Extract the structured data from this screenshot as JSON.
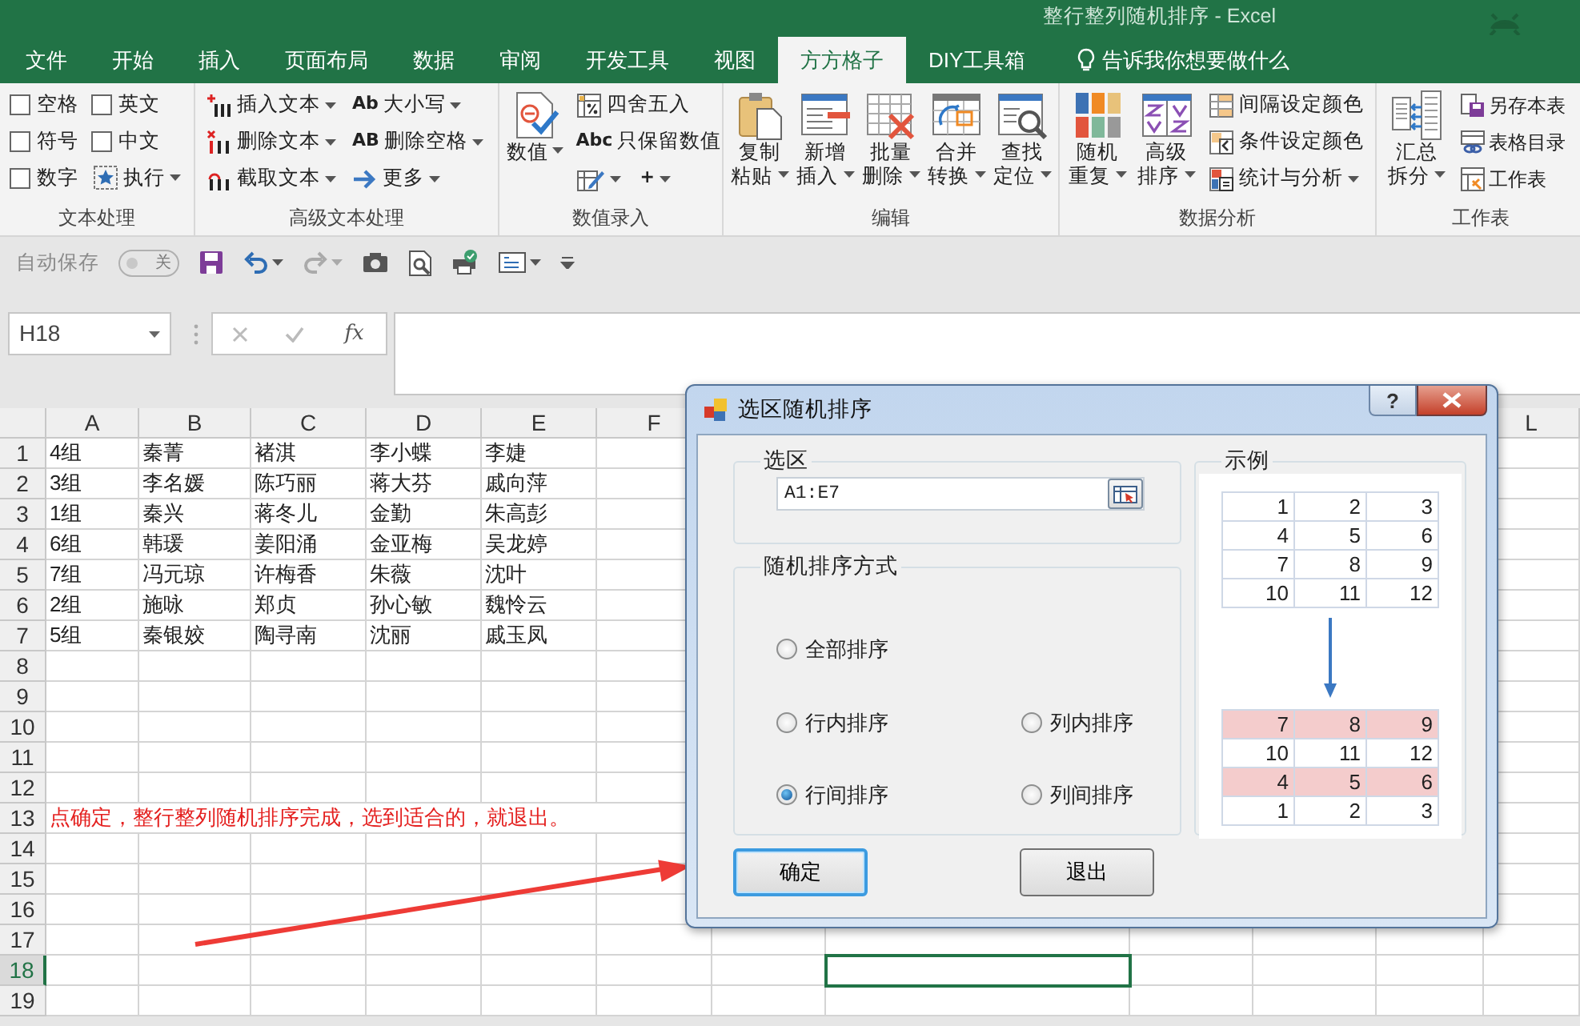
{
  "window": {
    "title": "整行整列随机排序  -  Excel"
  },
  "tabs": [
    {
      "label": "文件",
      "selected": false
    },
    {
      "label": "开始",
      "selected": false
    },
    {
      "label": "插入",
      "selected": false
    },
    {
      "label": "页面布局",
      "selected": false
    },
    {
      "label": "数据",
      "selected": false
    },
    {
      "label": "审阅",
      "selected": false
    },
    {
      "label": "开发工具",
      "selected": false
    },
    {
      "label": "视图",
      "selected": false
    },
    {
      "label": "方方格子",
      "selected": true
    },
    {
      "label": "DIY工具箱",
      "selected": false
    }
  ],
  "tell_me": "告诉我你想要做什么",
  "ribbon": {
    "groups": [
      {
        "label": "文本处理",
        "items": [
          {
            "kind": "checkbox",
            "label": "空格",
            "checked": false
          },
          {
            "kind": "checkbox",
            "label": "英文",
            "checked": false
          },
          {
            "kind": "checkbox",
            "label": "符号",
            "checked": false
          },
          {
            "kind": "checkbox",
            "label": "中文",
            "checked": false
          },
          {
            "kind": "checkbox",
            "label": "数字",
            "checked": false
          },
          {
            "kind": "small",
            "label": "执行",
            "dropdown": true
          }
        ]
      },
      {
        "label": "高级文本处理",
        "items": [
          {
            "kind": "small",
            "label": "插入文本",
            "dropdown": true
          },
          {
            "kind": "small",
            "label": "删除文本",
            "dropdown": true
          },
          {
            "kind": "small",
            "label": "截取文本",
            "dropdown": true
          },
          {
            "kind": "small",
            "glyph": "Ab",
            "label": "大小写",
            "dropdown": true
          },
          {
            "kind": "small",
            "glyph": "AB",
            "label": "删除空格",
            "dropdown": true
          },
          {
            "kind": "small",
            "label": "更多",
            "dropdown": true
          }
        ]
      },
      {
        "label": "数值录入",
        "items": [
          {
            "kind": "large",
            "label": "数值",
            "dropdown": true
          },
          {
            "kind": "small",
            "label": "四舍五入",
            "dropdown": false
          },
          {
            "kind": "small",
            "glyph": "Abc",
            "label": "只保留数值",
            "dropdown": false
          },
          {
            "kind": "icon",
            "dropdown": true
          },
          {
            "kind": "icon",
            "glyph": "+",
            "dropdown": true
          }
        ]
      },
      {
        "label": "编辑",
        "items": [
          {
            "kind": "large",
            "label": "复制粘贴",
            "dropdown": true
          },
          {
            "kind": "large",
            "label": "新增插入",
            "dropdown": true
          },
          {
            "kind": "large",
            "label": "批量删除",
            "dropdown": true
          },
          {
            "kind": "large",
            "label": "合并转换",
            "dropdown": true
          },
          {
            "kind": "large",
            "label": "查找定位",
            "dropdown": true
          }
        ]
      },
      {
        "label": "数据分析",
        "items": [
          {
            "kind": "large",
            "label": "随机重复",
            "dropdown": true
          },
          {
            "kind": "large",
            "label": "高级排序",
            "dropdown": true
          },
          {
            "kind": "small",
            "label": "间隔设定颜色",
            "dropdown": false
          },
          {
            "kind": "small",
            "label": "条件设定颜色",
            "dropdown": false
          },
          {
            "kind": "small",
            "label": "统计与分析",
            "dropdown": true
          }
        ]
      },
      {
        "label": "工作表",
        "items": [
          {
            "kind": "large",
            "label": "汇总拆分",
            "dropdown": true
          },
          {
            "kind": "small",
            "label": "另存本表",
            "dropdown": false
          },
          {
            "kind": "small",
            "label": "表格目录",
            "dropdown": false
          },
          {
            "kind": "small",
            "label": "工作表",
            "dropdown": false
          }
        ]
      }
    ]
  },
  "quick_access": {
    "autosave": {
      "label": "自动保存",
      "state": "关",
      "on": false
    }
  },
  "formula_bar": {
    "name_box": "H18",
    "fx": "fx"
  },
  "sheet": {
    "columns": [
      "A",
      "B",
      "C",
      "D",
      "E",
      "F",
      "L"
    ],
    "rows": [
      {
        "number": "1",
        "selected": false,
        "cells": [
          "4组",
          "秦菁",
          "褚淇",
          "李小蝶",
          "李婕"
        ]
      },
      {
        "number": "2",
        "selected": false,
        "cells": [
          "3组",
          "李名媛",
          "陈巧丽",
          "蒋大芬",
          "戚向萍"
        ]
      },
      {
        "number": "3",
        "selected": false,
        "cells": [
          "1组",
          "秦兴",
          "蒋冬儿",
          "金勤",
          "朱高彭"
        ]
      },
      {
        "number": "4",
        "selected": false,
        "cells": [
          "6组",
          "韩瑗",
          "姜阳涌",
          "金亚梅",
          "吴龙婷"
        ]
      },
      {
        "number": "5",
        "selected": false,
        "cells": [
          "7组",
          "冯元琼",
          "许梅香",
          "朱薇",
          "沈叶"
        ]
      },
      {
        "number": "6",
        "selected": false,
        "cells": [
          "2组",
          "施咏",
          "郑贞",
          "孙心敏",
          "魏怜云"
        ]
      },
      {
        "number": "7",
        "selected": false,
        "cells": [
          "5组",
          "秦银姣",
          "陶寻南",
          "沈丽",
          "戚玉凤"
        ]
      },
      {
        "number": "8",
        "selected": false
      },
      {
        "number": "9",
        "selected": false
      },
      {
        "number": "10",
        "selected": false
      },
      {
        "number": "11",
        "selected": false
      },
      {
        "number": "12",
        "selected": false
      },
      {
        "number": "13",
        "selected": false,
        "note": "点确定，整行整列随机排序完成，选到适合的，就退出。"
      },
      {
        "number": "14",
        "selected": false
      },
      {
        "number": "15",
        "selected": false
      },
      {
        "number": "16",
        "selected": false
      },
      {
        "number": "17",
        "selected": false
      },
      {
        "number": "18",
        "selected": true
      },
      {
        "number": "19",
        "selected": false
      }
    ]
  },
  "dialog": {
    "title": "选区随机排序",
    "help": "?",
    "range_group": "选区",
    "range": "A1:E7",
    "mode_group": "随机排序方式",
    "modes": [
      {
        "label": "全部排序",
        "selected": false
      },
      {
        "label": "行内排序",
        "selected": false
      },
      {
        "label": "列内排序",
        "selected": false
      },
      {
        "label": "行间排序",
        "selected": true
      },
      {
        "label": "列间排序",
        "selected": false
      }
    ],
    "example_group": "示例",
    "example_before": [
      [
        "1",
        "2",
        "3"
      ],
      [
        "4",
        "5",
        "6"
      ],
      [
        "7",
        "8",
        "9"
      ],
      [
        "10",
        "11",
        "12"
      ]
    ],
    "example_after": [
      {
        "cells": [
          "7",
          "8",
          "9"
        ],
        "highlighted": true
      },
      {
        "cells": [
          "10",
          "11",
          "12"
        ],
        "highlighted": false
      },
      {
        "cells": [
          "4",
          "5",
          "6"
        ],
        "highlighted": true
      },
      {
        "cells": [
          "1",
          "2",
          "3"
        ],
        "highlighted": false
      }
    ],
    "buttons": [
      {
        "label": "确定",
        "focused": true
      },
      {
        "label": "退出",
        "focused": false
      }
    ]
  }
}
